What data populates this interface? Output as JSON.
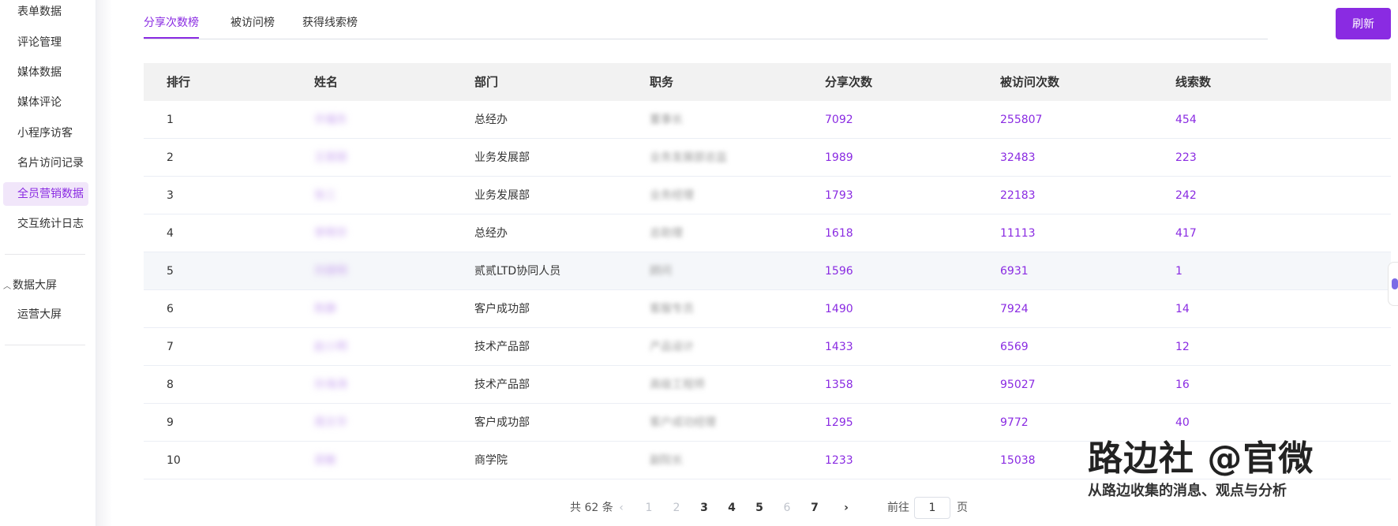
{
  "sidebar": {
    "items": [
      {
        "label": "表单数据"
      },
      {
        "label": "评论管理"
      },
      {
        "label": "媒体数据"
      },
      {
        "label": "媒体评论"
      },
      {
        "label": "小程序访客"
      },
      {
        "label": "名片访问记录"
      },
      {
        "label": "全员营销数据"
      },
      {
        "label": "交互统计日志"
      }
    ],
    "group": {
      "label": "数据大屏",
      "items": [
        {
          "label": "运营大屏"
        }
      ]
    }
  },
  "tabs": [
    {
      "label": "分享次数榜"
    },
    {
      "label": "被访问榜"
    },
    {
      "label": "获得线索榜"
    }
  ],
  "toolbar": {
    "refresh_label": "刷新"
  },
  "table": {
    "headers": [
      "排行",
      "姓名",
      "部门",
      "职务",
      "分享次数",
      "被访问次数",
      "线索数"
    ],
    "rows": [
      {
        "rank": "1",
        "name": "许福东",
        "dept": "总经办",
        "title": "董事长",
        "shares": "7092",
        "visits": "255807",
        "leads": "454"
      },
      {
        "rank": "2",
        "name": "王丽丽",
        "dept": "业务发展部",
        "title": "业务发展部总监",
        "shares": "1989",
        "visits": "32483",
        "leads": "223"
      },
      {
        "rank": "3",
        "name": "张三",
        "dept": "业务发展部",
        "title": "业务经理",
        "shares": "1793",
        "visits": "22183",
        "leads": "242"
      },
      {
        "rank": "4",
        "name": "李明华",
        "dept": "总经办",
        "title": "总助理",
        "shares": "1618",
        "visits": "11113",
        "leads": "417"
      },
      {
        "rank": "5",
        "name": "刘德明",
        "dept": "贰贰LTD协同人员",
        "title": "顾问",
        "shares": "1596",
        "visits": "6931",
        "leads": "1"
      },
      {
        "rank": "6",
        "name": "陈静",
        "dept": "客户成功部",
        "title": "客服专员",
        "shares": "1490",
        "visits": "7924",
        "leads": "14"
      },
      {
        "rank": "7",
        "name": "赵小明",
        "dept": "技术产品部",
        "title": "产品设计",
        "shares": "1433",
        "visits": "6569",
        "leads": "12"
      },
      {
        "rank": "8",
        "name": "孙海涛",
        "dept": "技术产品部",
        "title": "高级工程师",
        "shares": "1358",
        "visits": "95027",
        "leads": "16"
      },
      {
        "rank": "9",
        "name": "周文华",
        "dept": "客户成功部",
        "title": "客户成功经理",
        "shares": "1295",
        "visits": "9772",
        "leads": "40"
      },
      {
        "rank": "10",
        "name": "吴敏",
        "dept": "商学院",
        "title": "副院长",
        "shares": "1233",
        "visits": "15038",
        "leads": ""
      }
    ]
  },
  "pager": {
    "total": "共 62 条",
    "prev": "‹",
    "next": "›",
    "pages": [
      "1",
      "2",
      "3",
      "4",
      "5",
      "6",
      "7"
    ],
    "goto_prefix": "前往",
    "goto_value": "1",
    "goto_suffix": "页"
  },
  "watermark": {
    "title": "路边社 @官微",
    "subtitle": "从路边收集的消息、观点与分析"
  }
}
